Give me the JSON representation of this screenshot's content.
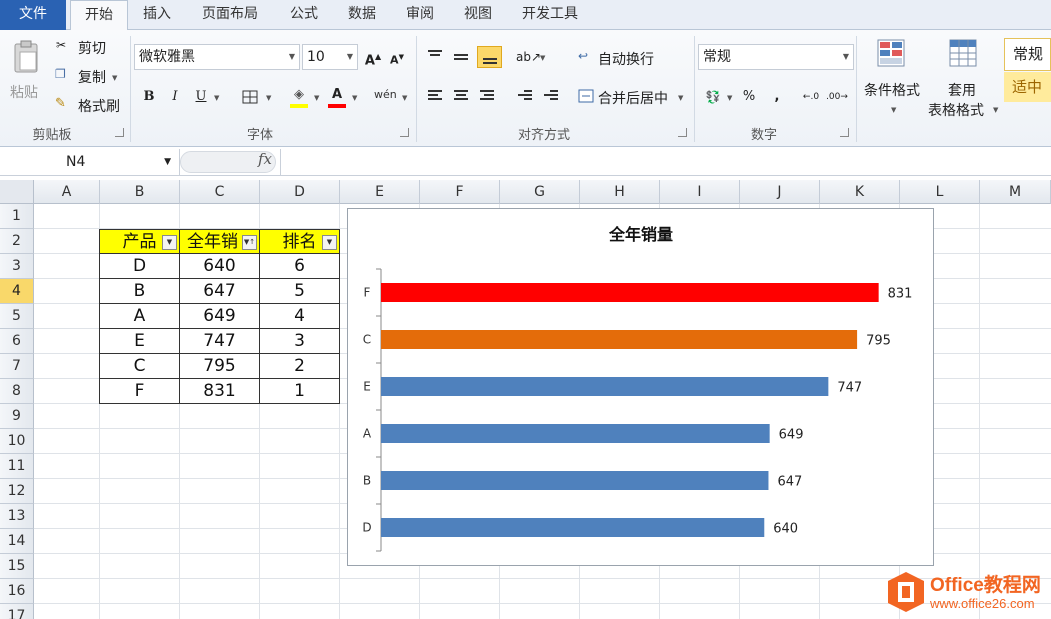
{
  "ribbon": {
    "tabs": [
      "文件",
      "开始",
      "插入",
      "页面布局",
      "公式",
      "数据",
      "审阅",
      "视图",
      "开发工具"
    ],
    "active_tab": "开始",
    "clipboard": {
      "paste": "粘贴",
      "cut": "剪切",
      "copy": "复制",
      "format_painter": "格式刷",
      "label": "剪贴板"
    },
    "font": {
      "name": "微软雅黑",
      "size": "10",
      "bold": "B",
      "italic": "I",
      "underline": "U",
      "label": "字体",
      "phonetic": "wén"
    },
    "alignment": {
      "wrap_text": "自动换行",
      "merge_center": "合并后居中",
      "label": "对齐方式"
    },
    "number": {
      "format": "常规",
      "percent": "%",
      "comma": ",",
      "label": "数字"
    },
    "styles": {
      "conditional_format": "条件格式",
      "format_table_line1": "套用",
      "format_table_line2": "表格格式",
      "style_normal": "常规",
      "style_neutral": "适中"
    }
  },
  "formula_bar": {
    "name_box": "N4",
    "fx": "fx",
    "formula": ""
  },
  "grid": {
    "columns": [
      "A",
      "B",
      "C",
      "D",
      "E",
      "F",
      "G",
      "H",
      "I",
      "J",
      "K",
      "L",
      "M"
    ],
    "rows": [
      "1",
      "2",
      "3",
      "4",
      "5",
      "6",
      "7",
      "8",
      "9",
      "10",
      "11",
      "12",
      "13",
      "14",
      "15",
      "16",
      "17"
    ],
    "selected_row": "4"
  },
  "table": {
    "headers": [
      "产品",
      "全年销",
      "排名"
    ],
    "rows": [
      [
        "D",
        "640",
        "6"
      ],
      [
        "B",
        "647",
        "5"
      ],
      [
        "A",
        "649",
        "4"
      ],
      [
        "E",
        "747",
        "3"
      ],
      [
        "C",
        "795",
        "2"
      ],
      [
        "F",
        "831",
        "1"
      ]
    ],
    "header_color": "#ffff00"
  },
  "chart_data": {
    "type": "bar",
    "orientation": "horizontal",
    "title": "全年销量",
    "categories": [
      "F",
      "C",
      "E",
      "A",
      "B",
      "D"
    ],
    "values": [
      831,
      795,
      747,
      649,
      647,
      640
    ],
    "data_labels": [
      "831",
      "795",
      "747",
      "649",
      "647",
      "640"
    ],
    "colors": [
      "#ff0000",
      "#e46c0a",
      "#4f81bd",
      "#4f81bd",
      "#4f81bd",
      "#4f81bd"
    ],
    "xlim": [
      0,
      880
    ],
    "grid": false,
    "legend": "none"
  },
  "watermark": {
    "brand": "Office教程网",
    "url": "www.office26.com",
    "color": "#f26522"
  },
  "colors": {
    "file_tab": "#2a62b3",
    "selected_highlight": "#fbd86a",
    "bar_default": "#4f81bd"
  }
}
